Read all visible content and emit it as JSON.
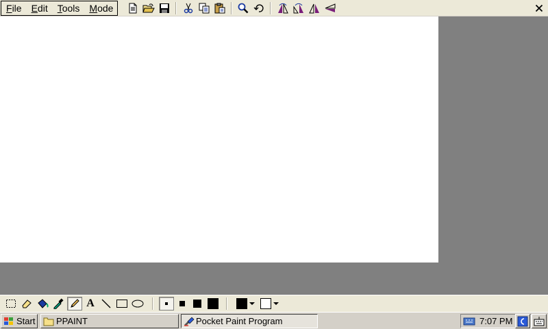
{
  "menu": {
    "items": [
      {
        "name": "menu-file",
        "label": "File"
      },
      {
        "name": "menu-edit",
        "label": "Edit"
      },
      {
        "name": "menu-tools",
        "label": "Tools"
      },
      {
        "name": "menu-mode",
        "label": "Mode"
      }
    ]
  },
  "toolbar": {
    "icons": [
      "new-file-icon",
      "open-folder-icon",
      "save-icon",
      "cut-icon",
      "copy-icon",
      "paste-icon",
      "zoom-icon",
      "undo-icon",
      "rotate-left-icon",
      "rotate-right-icon",
      "flip-horizontal-icon",
      "flip-vertical-icon"
    ]
  },
  "close_icon": "close-icon",
  "palette": {
    "tools": [
      "select-rect-icon",
      "eraser-icon",
      "fill-bucket-icon",
      "eyedropper-icon",
      "pencil-icon",
      "text-tool-icon",
      "line-tool-icon",
      "rectangle-tool-icon",
      "ellipse-tool-icon"
    ],
    "selected_tool": "pencil-icon",
    "text_tool_glyph": "A",
    "brush_sizes": [
      "brush-size-1",
      "brush-size-2",
      "brush-size-3",
      "brush-size-4"
    ],
    "selected_brush": "brush-size-1",
    "foreground_color": "#000000",
    "background_color": "#ffffff"
  },
  "taskbar": {
    "start_label": "Start",
    "tasks": [
      {
        "label": "PPAINT"
      },
      {
        "label": "Pocket Paint Program"
      }
    ],
    "clock": "7:07 PM"
  }
}
